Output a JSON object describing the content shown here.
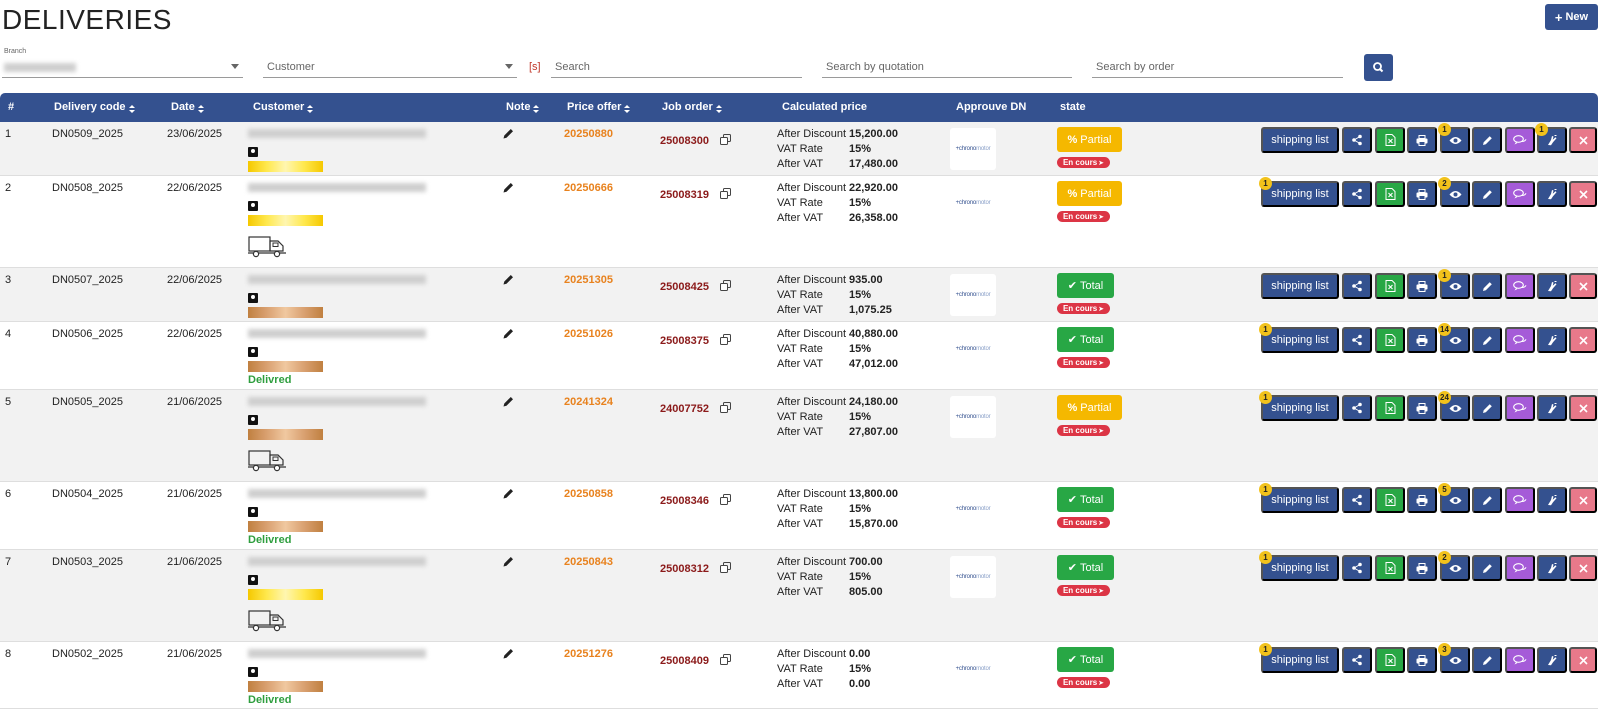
{
  "page": {
    "title": "DELIVERIES",
    "new_label": "New"
  },
  "filters": {
    "branch_label": "Branch",
    "customer_placeholder": "Customer",
    "s_label": "[s]",
    "search_placeholder": "Search",
    "quotation_placeholder": "Search by quotation",
    "order_placeholder": "Search by order"
  },
  "columns": {
    "num": "#",
    "delivery_code": "Delivery code",
    "date": "Date",
    "customer": "Customer",
    "note": "Note",
    "price_offer": "Price offer",
    "job_order": "Job order",
    "calculated_price": "Calculated price",
    "approve_dn": "Approuve DN",
    "state": "state"
  },
  "labels": {
    "after_discount": "After Discount",
    "vat_rate": "VAT Rate",
    "after_vat": "After VAT",
    "shipping_list": "shipping list",
    "en_cours": "En cours",
    "delivered": "Delivred",
    "logo_part1": "chrono",
    "logo_part2": "motor"
  },
  "colors": {
    "primary": "#34518f",
    "partial": "#f5b800",
    "total": "#28a745",
    "danger": "#dc3545",
    "price_offer": "#e8821e",
    "job_order": "#8b1a1a",
    "chat": "#a55bd8",
    "delete": "#e8798a",
    "badge": "#f2c21b"
  },
  "rows": [
    {
      "num": "1",
      "code": "DN0509_2025",
      "date": "23/06/2025",
      "bar": "yellow",
      "truck": false,
      "delivered": false,
      "price_offer": "20250880",
      "job_order": "25008300",
      "after_discount": "15,200.00",
      "vat_rate": "15%",
      "after_vat": "17,480.00",
      "state": "Partial",
      "state_type": "partial",
      "badges": {
        "ship": "",
        "eye": "1",
        "hand": "1"
      }
    },
    {
      "num": "2",
      "code": "DN0508_2025",
      "date": "22/06/2025",
      "bar": "yellow",
      "truck": true,
      "delivered": false,
      "price_offer": "20250666",
      "job_order": "25008319",
      "after_discount": "22,920.00",
      "vat_rate": "15%",
      "after_vat": "26,358.00",
      "state": "Partial",
      "state_type": "partial",
      "badges": {
        "ship": "1",
        "eye": "2",
        "hand": ""
      }
    },
    {
      "num": "3",
      "code": "DN0507_2025",
      "date": "22/06/2025",
      "bar": "bronze",
      "truck": false,
      "delivered": false,
      "price_offer": "20251305",
      "job_order": "25008425",
      "after_discount": "935.00",
      "vat_rate": "15%",
      "after_vat": "1,075.25",
      "state": "Total",
      "state_type": "total",
      "badges": {
        "ship": "",
        "eye": "1",
        "hand": ""
      }
    },
    {
      "num": "4",
      "code": "DN0506_2025",
      "date": "22/06/2025",
      "bar": "bronze",
      "truck": false,
      "delivered": true,
      "price_offer": "20251026",
      "job_order": "25008375",
      "after_discount": "40,880.00",
      "vat_rate": "15%",
      "after_vat": "47,012.00",
      "state": "Total",
      "state_type": "total",
      "badges": {
        "ship": "1",
        "eye": "14",
        "hand": ""
      }
    },
    {
      "num": "5",
      "code": "DN0505_2025",
      "date": "21/06/2025",
      "bar": "bronze",
      "truck": true,
      "delivered": false,
      "price_offer": "20241324",
      "job_order": "24007752",
      "after_discount": "24,180.00",
      "vat_rate": "15%",
      "after_vat": "27,807.00",
      "state": "Partial",
      "state_type": "partial",
      "badges": {
        "ship": "1",
        "eye": "24",
        "hand": ""
      }
    },
    {
      "num": "6",
      "code": "DN0504_2025",
      "date": "21/06/2025",
      "bar": "bronze",
      "truck": false,
      "delivered": true,
      "price_offer": "20250858",
      "job_order": "25008346",
      "after_discount": "13,800.00",
      "vat_rate": "15%",
      "after_vat": "15,870.00",
      "state": "Total",
      "state_type": "total",
      "badges": {
        "ship": "1",
        "eye": "5",
        "hand": ""
      }
    },
    {
      "num": "7",
      "code": "DN0503_2025",
      "date": "21/06/2025",
      "bar": "yellow",
      "truck": true,
      "delivered": false,
      "price_offer": "20250843",
      "job_order": "25008312",
      "after_discount": "700.00",
      "vat_rate": "15%",
      "after_vat": "805.00",
      "state": "Total",
      "state_type": "total",
      "badges": {
        "ship": "1",
        "eye": "2",
        "hand": ""
      }
    },
    {
      "num": "8",
      "code": "DN0502_2025",
      "date": "21/06/2025",
      "bar": "bronze",
      "truck": false,
      "delivered": true,
      "price_offer": "20251276",
      "job_order": "25008409",
      "after_discount": "0.00",
      "vat_rate": "15%",
      "after_vat": "0.00",
      "state": "Total",
      "state_type": "total",
      "badges": {
        "ship": "1",
        "eye": "3",
        "hand": ""
      }
    }
  ]
}
